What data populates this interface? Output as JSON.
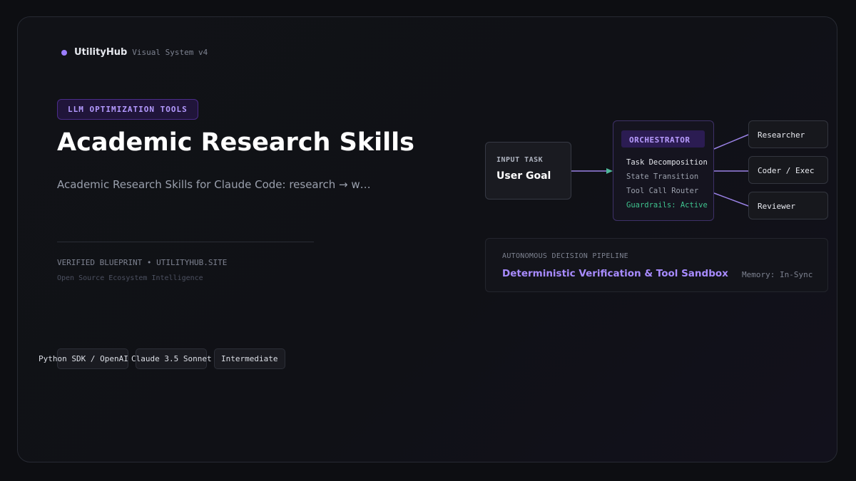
{
  "brand": {
    "name": "UtilityHub",
    "subtitle": "Visual System v4"
  },
  "hero": {
    "tag": "LLM OPTIMIZATION TOOLS",
    "title": "Academic Research Skills",
    "description": "Academic Research Skills for Claude Code: research → w…",
    "verified": "VERIFIED BLUEPRINT • UTILITYHUB.SITE",
    "ecosystem": "Open Source Ecosystem Intelligence"
  },
  "chips": [
    "Python SDK / OpenAI",
    "Claude 3.5 Sonnet",
    "Intermediate"
  ],
  "diagram": {
    "input": {
      "label": "INPUT TASK",
      "goal": "User Goal"
    },
    "orchestrator": {
      "title": "ORCHESTRATOR",
      "steps": [
        "Task Decomposition",
        "State Transition",
        "Tool Call Router"
      ],
      "guardrails": "Guardrails: Active"
    },
    "agents": [
      "Researcher",
      "Coder / Exec",
      "Reviewer"
    ],
    "pipeline": {
      "label": "AUTONOMOUS DECISION PIPELINE",
      "title": "Deterministic Verification & Tool Sandbox",
      "memory": "Memory: In-Sync"
    }
  },
  "colors": {
    "accent": "#9b7dff",
    "guardrails": "#3fc38e",
    "arrow": "#4fb89a",
    "connector": "#9a82e6"
  }
}
